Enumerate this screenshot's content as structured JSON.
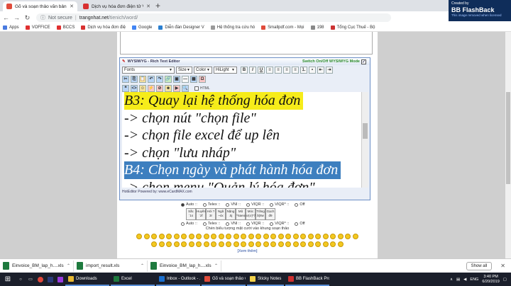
{
  "browser": {
    "tabs": [
      {
        "title": "Gõ và soạn thảo văn bản, HTML",
        "color": "#e04b3b",
        "active": true
      },
      {
        "title": "Dịch vụ hóa đơn điện tử Viettel",
        "color": "#d83030",
        "active": false
      }
    ],
    "url": {
      "security": "Not secure",
      "host": "trangnhat.net",
      "path": "/tienich/word/"
    }
  },
  "bookmarks": [
    {
      "label": "Apps",
      "color": "#4a7be0"
    },
    {
      "label": "VOFFICE",
      "color": "#e03030"
    },
    {
      "label": "BCCS",
      "color": "#e03030"
    },
    {
      "label": "Dịch vụ hóa đơn điệ",
      "color": "#d83030"
    },
    {
      "label": "Google",
      "color": "#4285f4"
    },
    {
      "label": "Diễn đàn Designer V",
      "color": "#2a7fd0"
    },
    {
      "label": "Hệ thống tra cứu hó",
      "color": "#999999"
    },
    {
      "label": "Smallpdf.com - Mọi",
      "color": "#e04b3b"
    },
    {
      "label": "198",
      "color": "#888888"
    },
    {
      "label": "Tổng Cục Thuế - Bộ",
      "color": "#cc3333"
    }
  ],
  "editor": {
    "title": "WYSIWYG - Rich Text Editor",
    "switch_label": "Switch On/Off WYSIWYG Mode",
    "fonts": "Fonts",
    "size": "Size",
    "color": "Color",
    "hilight": "HiLight",
    "html_label": "HTML",
    "footer": "HotEditor Powered by: www.eCardMAX.com"
  },
  "document": {
    "lines": [
      "B3: Quay lại hệ thống hóa đơn",
      "-> chọn nút \"chọn file\"",
      "-> chọn file excel để up lên",
      "-> chọn \"lưu nháp\"",
      "B4: Chọn ngày và phát hành hóa đơn",
      "-> chọn menu \"Quản lý hóa đơn\""
    ]
  },
  "input_mode": {
    "row1": [
      "Auto ::",
      "Telex ::",
      "VNI ::",
      "VIQR ::",
      "VIQR* ::",
      "Off"
    ],
    "row1_selected": 0,
    "keys": [
      "Sắc ´1s",
      "Huyền `2f",
      "Hỏi ?3r",
      "Ngã ~4x",
      "Nặng .5j",
      "Mũ ^6aeoo",
      "Móc ư(ơ)*7w",
      "Trăng ă(8w",
      "Gạch đ9"
    ],
    "row2": [
      "Auto ::",
      "Telex ::",
      "VNI ::",
      "VIQR ::",
      "VIQR* ::",
      "Off"
    ]
  },
  "emoticons": {
    "title": "Chèn biểu tượng mặt cười vào khung soạn thảo",
    "more": "[Xem thêm]"
  },
  "badge": {
    "created_by": "Created by",
    "brand": "BB FlashBack",
    "note": "This image removed when licensed"
  },
  "downloads": [
    {
      "name": "Einvoice_BM_lap_h....xls",
      "color": "#1e7a3e"
    },
    {
      "name": "import_result.xls",
      "color": "#1e7a3e"
    },
    {
      "name": "Einvoice_BM_lap_h....xls",
      "color": "#1e7a3e"
    }
  ],
  "downloads_show_all": "Show all",
  "taskbar": {
    "apps": [
      {
        "label": "Downloads",
        "color": "#e8b832"
      },
      {
        "label": "Excel",
        "color": "#1e7a3e"
      },
      {
        "label": "Inbox - Outlook - ...",
        "color": "#1a6fcf"
      },
      {
        "label": "Gõ và soạn thảo vă...",
        "color": "#e04b3b"
      },
      {
        "label": "Sticky Notes",
        "color": "#f3d24b"
      },
      {
        "label": "BB FlashBack Pro 5...",
        "color": "#d03030"
      }
    ],
    "lang": "ENG",
    "time": "3:40 PM",
    "date": "6/20/2019"
  }
}
